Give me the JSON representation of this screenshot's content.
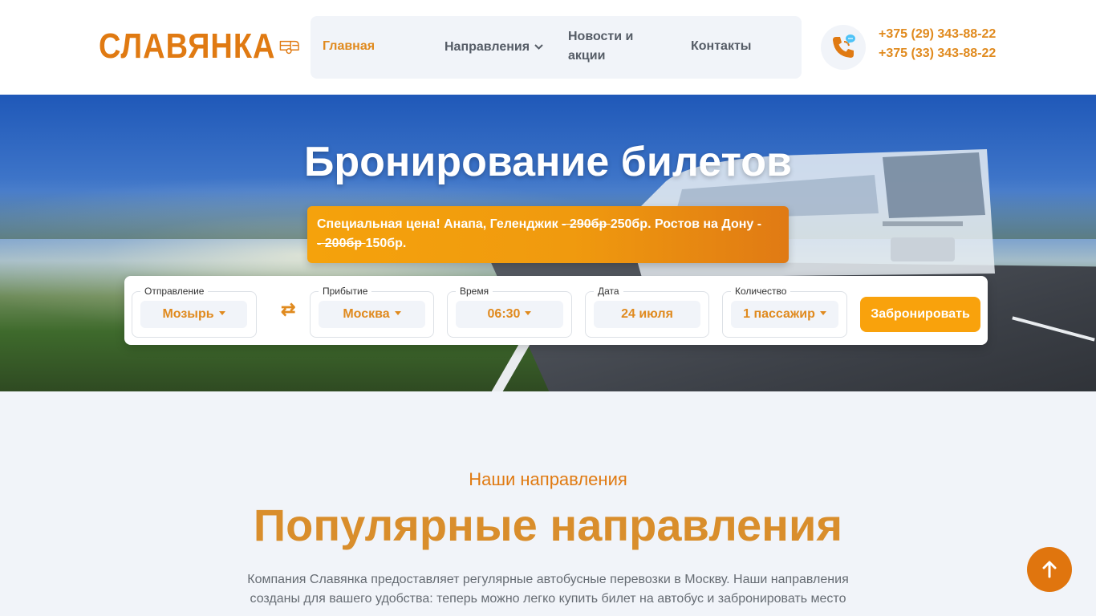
{
  "header": {
    "logo_text": "СЛАВЯНКА",
    "nav": [
      {
        "label": "Главная"
      },
      {
        "label": "Направления"
      },
      {
        "label": "Новости и"
      },
      {
        "label": "акции"
      },
      {
        "label": "Контакты"
      }
    ],
    "phones": [
      "+375 (29) 343-88-22",
      "+375 (33) 343-88-22"
    ]
  },
  "hero": {
    "title": "Бронирование билетов",
    "promo": {
      "lead": "Специальная цена!",
      "text1": " Анапа, Геленджик ",
      "old1": "- 290бр ",
      "new1": "250бр. Ростов на Дону -",
      "old2": "- 200бр ",
      "new2": "150бр."
    }
  },
  "booking": {
    "departure_label": "Отправление",
    "departure_value": "Мозырь",
    "arrival_label": "Прибытие",
    "arrival_value": "Москва",
    "time_label": "Время",
    "time_value": "06:30",
    "date_label": "Дата",
    "date_value": "24 июля",
    "count_label": "Количество",
    "count_value": "1 пассажир",
    "submit_label": "Забронировать",
    "swap_icon": "swap-arrows-icon"
  },
  "directions": {
    "eyebrow": "Наши направления",
    "title": "Популярные направления",
    "description": "Компания Славянка предоставляет регулярные автобусные перевозки в Москву. Наши направления созданы для вашего удобства: теперь можно легко купить билет на автобус и забронировать место"
  },
  "colors": {
    "accent": "#e08a1e",
    "promo_bg": "#f5a20c",
    "button_bg": "#f9a20c",
    "to_top_bg": "#e0750e"
  }
}
